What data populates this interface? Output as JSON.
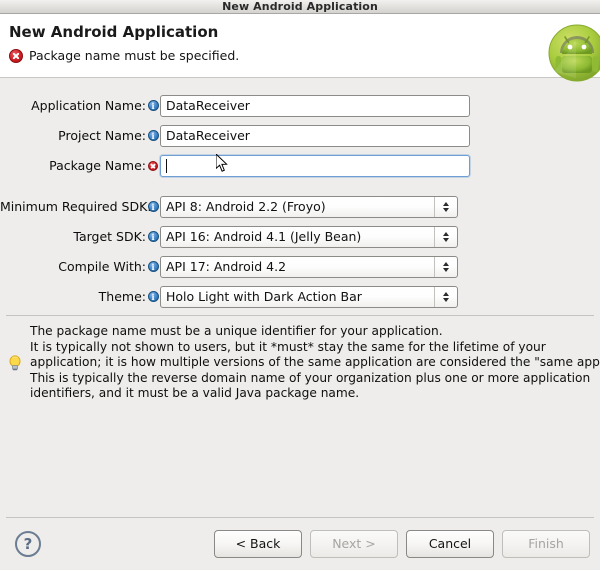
{
  "window": {
    "title": "New Android Application"
  },
  "header": {
    "title": "New Android Application",
    "error_message": "Package name must be specified.",
    "error_icon": "error-circle-icon",
    "logo_icon": "android-robot-icon"
  },
  "form": {
    "fields": [
      {
        "label": "Application Name:",
        "icon": "info-icon",
        "value": "DataReceiver",
        "type": "text",
        "focused": false
      },
      {
        "label": "Project Name:",
        "icon": "info-icon",
        "value": "DataReceiver",
        "type": "text",
        "focused": false
      },
      {
        "label": "Package Name:",
        "icon": "error-icon",
        "value": "",
        "type": "text",
        "focused": true
      }
    ],
    "dropdowns": [
      {
        "label": "Minimum Required SDK:",
        "icon": "info-icon",
        "value": "API 8: Android 2.2 (Froyo)"
      },
      {
        "label": "Target SDK:",
        "icon": "info-icon",
        "value": "API 16: Android 4.1 (Jelly Bean)"
      },
      {
        "label": "Compile With:",
        "icon": "info-icon",
        "value": "API 17: Android 4.2"
      },
      {
        "label": "Theme:",
        "icon": "info-icon",
        "value": "Holo Light with Dark Action Bar"
      }
    ]
  },
  "help": {
    "icon": "lightbulb-icon",
    "lines": [
      "The package name must be a unique identifier for your application.",
      "It is typically not shown to users, but it *must* stay the same for the lifetime of your",
      "application; it is how multiple versions of the same application are considered the \"same app\"",
      "This is typically the reverse domain name of your organization plus one or more application",
      "identifiers, and it must be a valid Java package name."
    ]
  },
  "buttons": {
    "help_label": "?",
    "back": {
      "label": "< Back",
      "disabled": false
    },
    "next": {
      "label": "Next >",
      "disabled": true
    },
    "cancel": {
      "label": "Cancel",
      "disabled": false
    },
    "finish": {
      "label": "Finish",
      "disabled": true
    }
  },
  "colors": {
    "error": "#cf2026",
    "info": "#3a7fc4",
    "accent_focus": "#6f9ed4",
    "android_green": "#a4c639",
    "background": "#eeedeb"
  }
}
